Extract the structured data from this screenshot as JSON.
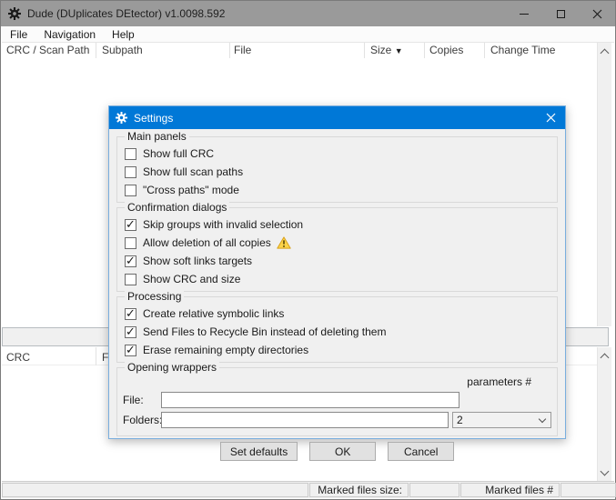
{
  "window": {
    "title": "Dude (DUplicates DEtector) v1.0098.592"
  },
  "menu": {
    "items": [
      "File",
      "Navigation",
      "Help"
    ]
  },
  "upper_table": {
    "columns": [
      "CRC / Scan Path",
      "Subpath",
      "File",
      "Size",
      "Copies",
      "Change Time"
    ],
    "sorted_column": "Size",
    "sort_indicator": "▼"
  },
  "lower_table": {
    "columns": [
      "CRC",
      "File"
    ]
  },
  "status_bar": {
    "marked_files_size_label": "Marked files size:",
    "marked_files_count_label": "Marked files #"
  },
  "dialog": {
    "title": "Settings",
    "groups": [
      {
        "title": "Main panels",
        "items": [
          {
            "label": "Show full CRC",
            "checked": false
          },
          {
            "label": "Show full scan paths",
            "checked": false
          },
          {
            "label": "\"Cross paths\" mode",
            "checked": false
          }
        ]
      },
      {
        "title": "Confirmation dialogs",
        "items": [
          {
            "label": "Skip groups with invalid selection",
            "checked": true
          },
          {
            "label": "Allow deletion of all copies",
            "checked": false,
            "warning": true
          },
          {
            "label": "Show soft links targets",
            "checked": true
          },
          {
            "label": "Show CRC and size",
            "checked": false
          }
        ]
      },
      {
        "title": "Processing",
        "items": [
          {
            "label": "Create relative symbolic links",
            "checked": true
          },
          {
            "label": "Send Files to Recycle Bin instead of deleting them",
            "checked": true
          },
          {
            "label": "Erase remaining empty directories",
            "checked": true
          }
        ]
      }
    ],
    "opening_wrappers": {
      "title": "Opening wrappers",
      "parameters_label": "parameters #",
      "file_label": "File:",
      "file_value": "",
      "folders_label": "Folders:",
      "folders_value": "",
      "folders_params_value": "2"
    },
    "buttons": [
      "Set defaults",
      "OK",
      "Cancel"
    ]
  },
  "icons": {
    "app_icon": "gear",
    "dialog_icon": "gear",
    "warning_icon": "warning-triangle",
    "combo_icon": "chevron-down"
  },
  "colors": {
    "accent": "#0078d7",
    "inactive_titlebar": "#9a9a9a",
    "dialog_bg": "#f0f0f0",
    "warning_fill": "#fbd34a",
    "warning_border": "#d9a21b"
  }
}
